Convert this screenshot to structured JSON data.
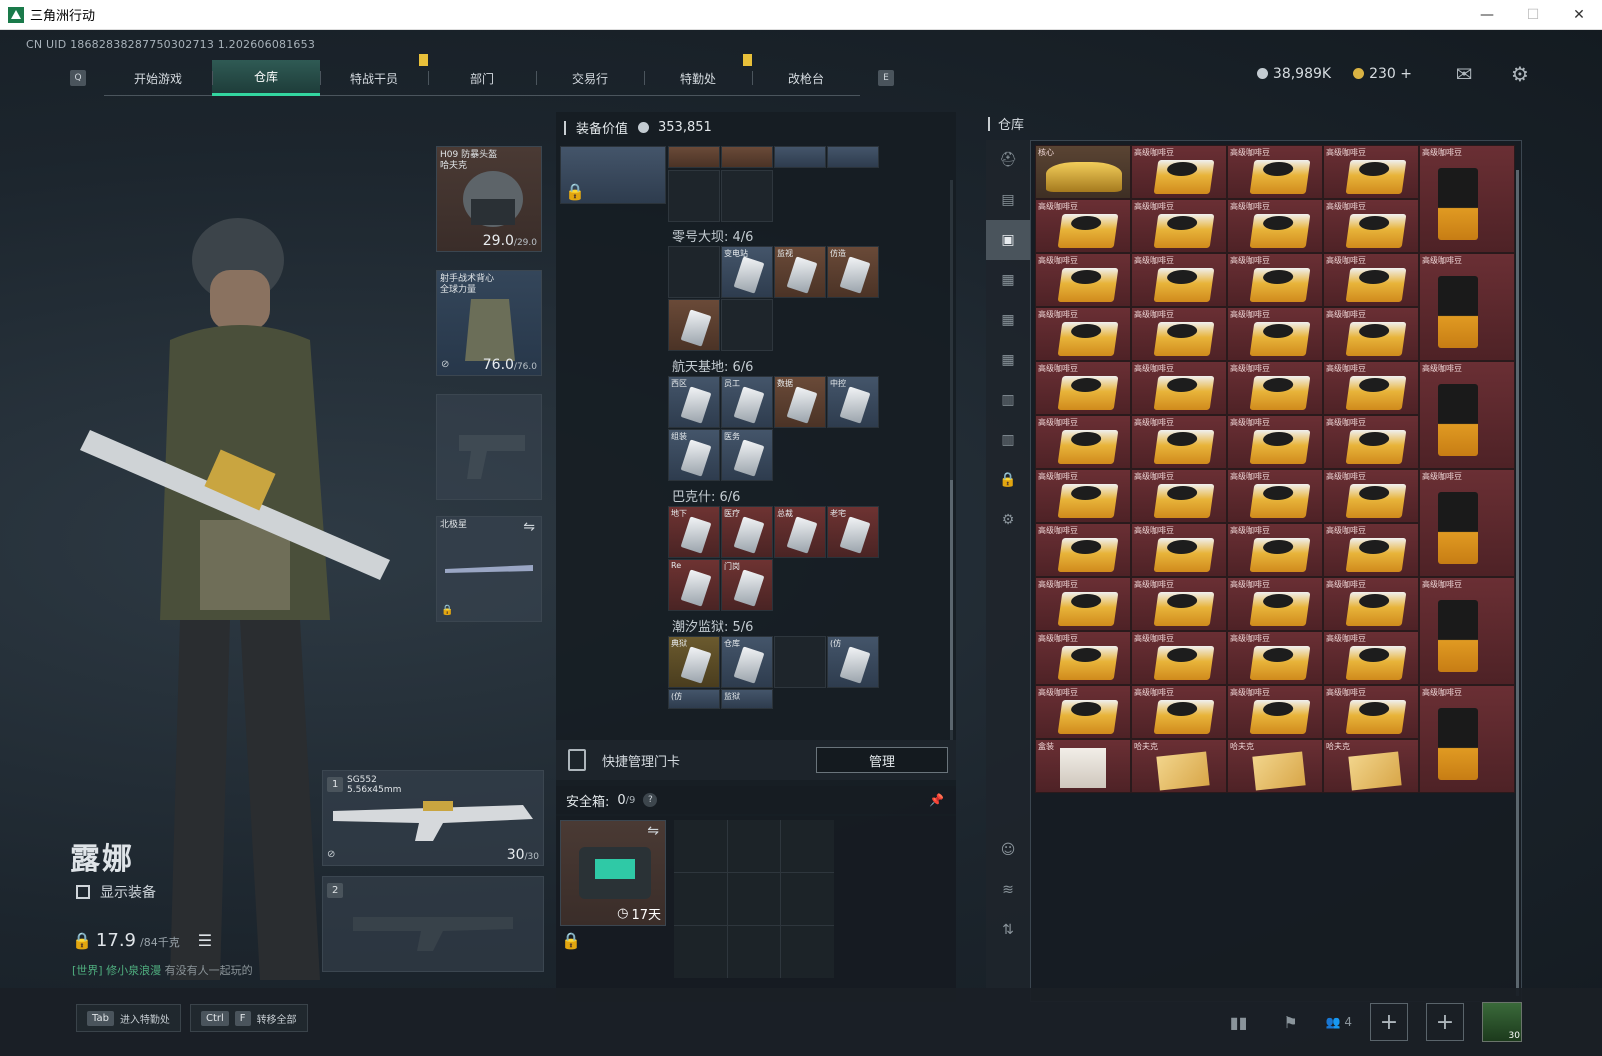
{
  "window": {
    "title": "三角洲行动",
    "minimize": "—",
    "maximize": "☐",
    "close": "✕"
  },
  "uid": "CN UID 18682838287750302713 1.202606081653",
  "nav": {
    "left_key": "Q",
    "right_key": "E",
    "tabs": [
      {
        "label": "开始游戏"
      },
      {
        "label": "仓库"
      },
      {
        "label": "特战干员"
      },
      {
        "label": "部门"
      },
      {
        "label": "交易行"
      },
      {
        "label": "特勤处"
      },
      {
        "label": "改枪台"
      }
    ],
    "active_tab": "仓库"
  },
  "currency": {
    "silver": "38,989K",
    "gold": "230",
    "gold_add": "+"
  },
  "character": {
    "name": "露娜",
    "show_equipment": "显示装备",
    "weight": "17.9",
    "weight_cap": "/84千克",
    "world_channel": "[世界]",
    "world_user": "修小泉浪漫",
    "world_msg": "有没有人一起玩的"
  },
  "equipment": {
    "helmet": {
      "name": "H09 防暴头盔",
      "sub": "哈夫克",
      "durability": "29.0",
      "max": "/29.0"
    },
    "armor": {
      "name": "射手战术背心",
      "sub": "全球力量",
      "durability": "76.0",
      "max": "/76.0"
    },
    "melee": {
      "name": "北极星"
    },
    "primary": {
      "slot": "1",
      "name": "SG552",
      "caliber": "5.56x45mm",
      "ammo": "30",
      "ammo_max": "/30"
    },
    "secondary": {
      "slot": "2"
    }
  },
  "bag": {
    "value_label": "装备价值",
    "value": "353,851",
    "sections": [
      {
        "title": "零号大坝: 4/6",
        "cards": [
          "变电站",
          "监视",
          "仿造"
        ]
      },
      {
        "title": "航天基地: 6/6",
        "cards": [
          "西区",
          "员工",
          "数据",
          "中控",
          "组装",
          "医务"
        ]
      },
      {
        "title": "巴克什: 6/6",
        "cards": [
          "地下",
          "医疗",
          "总裁",
          "老宅",
          "Re",
          "门岗"
        ]
      },
      {
        "title": "潮汐监狱: 5/6",
        "cards": [
          "典狱",
          "仓库",
          "(仿",
          "(仿",
          "监狱"
        ]
      }
    ],
    "quick_manage": "快捷管理门卡",
    "manage_button": "管理"
  },
  "safe": {
    "label": "安全箱:",
    "count": "0",
    "cap": "/9",
    "help": "?",
    "days": "17天"
  },
  "stash": {
    "title": "仓库",
    "items": {
      "gold": "核心",
      "bean": "高级咖啡豆",
      "box": "盒装",
      "hafu": "哈夫克"
    }
  },
  "bottom": {
    "tab_key": "Tab",
    "tab_label": "进入特勤处",
    "ctrl_key": "Ctrl",
    "f_key": "F",
    "ctrl_label": "转移全部",
    "friends": "4",
    "level": "30"
  },
  "colors": {
    "accent": "#33d6a0",
    "item_red": "#6a2f34",
    "flag": "#e8c03a"
  }
}
